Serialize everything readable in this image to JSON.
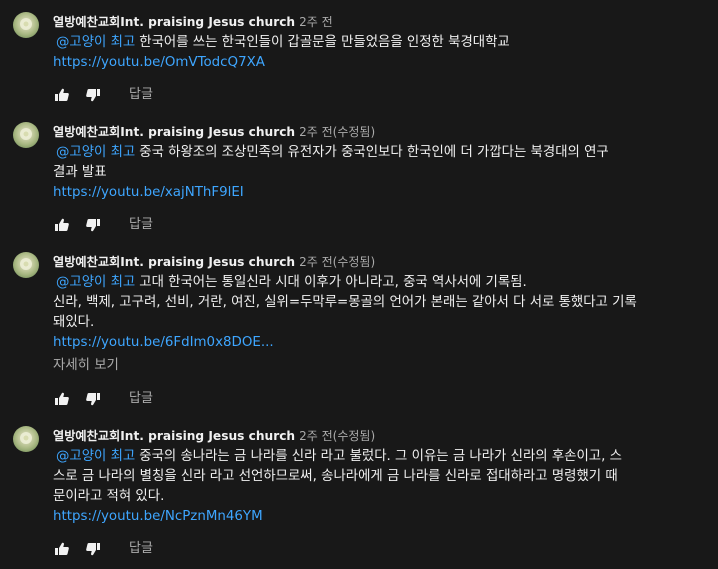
{
  "comments": [
    {
      "author": "열방예찬교회Int. praising Jesus church",
      "time": "2주 전",
      "mention": "@고양이 최고",
      "text_lines": [
        "한국어를 쓰는 한국인들이 갑골문을 만들었음을 인정한 북경대학교"
      ],
      "link": "https://youtu.be/OmVTodcQ7XA",
      "reply_label": "답글"
    },
    {
      "author": "열방예찬교회Int. praising Jesus church",
      "time": "2주 전(수정됨)",
      "mention": "@고양이 최고",
      "text_lines": [
        "중국 하왕조의 조상민족의 유전자가 중국인보다 한국인에 더 가깝다는 북경대의 연구",
        "결과 발표"
      ],
      "link": "https://youtu.be/xajNThF9lEI",
      "reply_label": "답글"
    },
    {
      "author": "열방예찬교회Int. praising Jesus church",
      "time": "2주 전(수정됨)",
      "mention": "@고양이 최고",
      "text_lines": [
        "고대 한국어는 통일신라 시대 이후가 아니라고, 중국 역사서에 기록됨.",
        "신라, 백제, 고구려, 선비, 거란, 여진, 실위=두막루=몽골의 언어가 본래는 같아서 다 서로 통했다고 기록",
        "돼있다."
      ],
      "link": "https://youtu.be/6FdIm0x8DOE...",
      "more_label": "자세히 보기",
      "reply_label": "답글"
    },
    {
      "author": "열방예찬교회Int. praising Jesus church",
      "time": "2주 전(수정됨)",
      "mention": "@고양이 최고",
      "text_lines": [
        "중국의 송나라는 금 나라를 신라 라고 불렀다. 그 이유는 금 나라가 신라의 후손이고, 스",
        "스로 금 나라의 별칭을 신라 라고 선언하므로써, 송나라에게 금 나라를 신라로 접대하라고 명령했기 때",
        "문이라고 적혀 있다."
      ],
      "link": "https://youtu.be/NcPznMn46YM",
      "reply_label": "답글"
    }
  ],
  "icons": {
    "like": "thumb-up-icon",
    "dislike": "thumb-down-icon",
    "avatar": "avatar"
  },
  "colors": {
    "background": "#181818",
    "text": "#f1f1f1",
    "secondary": "#aaaaaa",
    "link": "#3ea6ff"
  }
}
